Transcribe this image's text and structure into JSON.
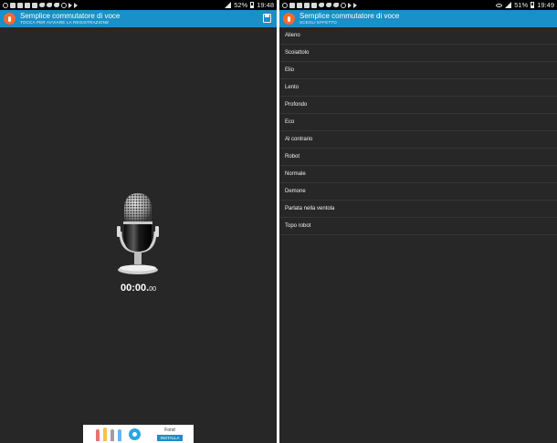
{
  "left": {
    "status": {
      "battery": "52%",
      "time": "19:48"
    },
    "app_title": "Semplice commutatore di voce",
    "app_subtitle": "TOCCA PER AVVIARE LA REGISTRAZIONE",
    "timer_main": "00:00.",
    "timer_ms": "00",
    "ad": {
      "brand": "Fond",
      "install": "INSTALLA"
    }
  },
  "right": {
    "status": {
      "battery": "51%",
      "time": "19:49"
    },
    "app_title": "Semplice commutatore di voce",
    "app_subtitle": "SCEGLI EFFETTO",
    "effects": [
      "Alieno",
      "Scoiattolo",
      "Elio",
      "Lento",
      "Profondo",
      "Eco",
      "Al contrario",
      "Robot",
      "Normale",
      "Demone",
      "Parlata nella ventola",
      "Topo robot"
    ]
  },
  "colors": {
    "appbar": "#1a8fc8",
    "logo": "#f26a2c",
    "background": "#272727"
  }
}
